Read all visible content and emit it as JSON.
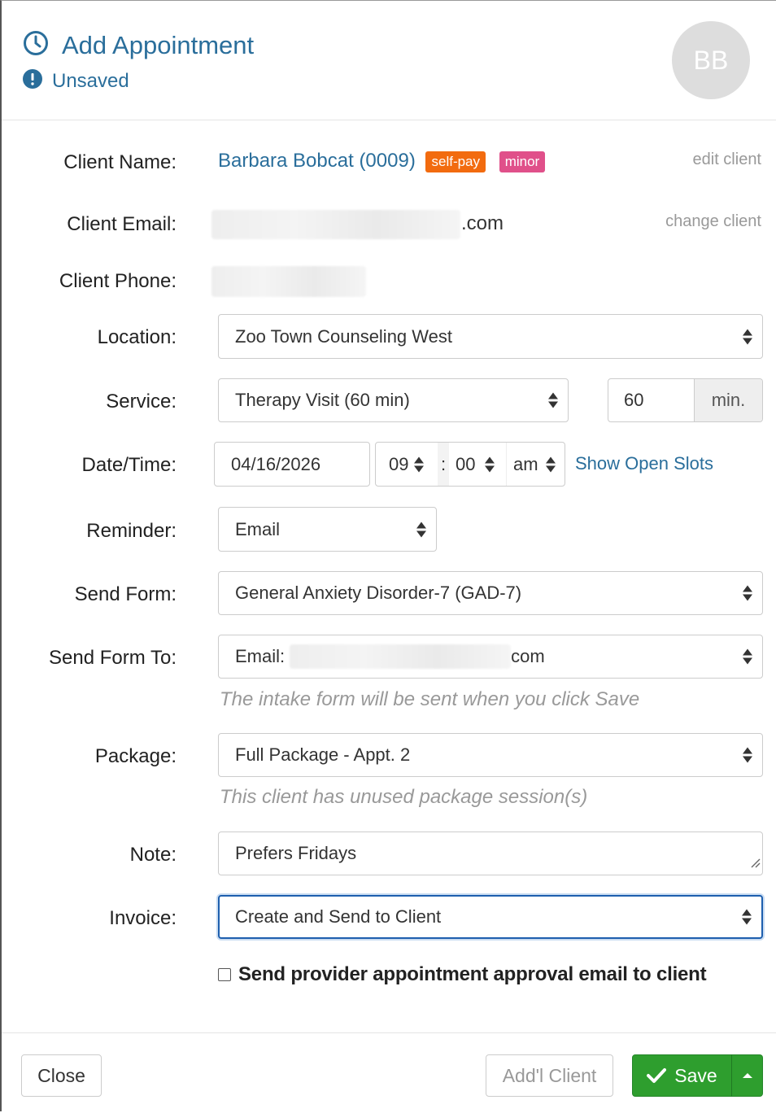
{
  "header": {
    "title": "Add Appointment",
    "status": "Unsaved",
    "avatar_initials": "BB"
  },
  "labels": {
    "client_name": "Client Name:",
    "client_email": "Client Email:",
    "client_phone": "Client Phone:",
    "location": "Location:",
    "service": "Service:",
    "datetime": "Date/Time:",
    "reminder": "Reminder:",
    "send_form": "Send Form:",
    "send_form_to": "Send Form To:",
    "package": "Package:",
    "note": "Note:",
    "invoice": "Invoice:"
  },
  "client": {
    "name": "Barbara Bobcat (0009)",
    "badge_selfpay": "self-pay",
    "badge_minor": "minor",
    "email_suffix": ".com",
    "edit_link": "edit client",
    "change_link": "change client"
  },
  "fields": {
    "location": "Zoo Town Counseling West",
    "service": "Therapy Visit (60 min)",
    "duration": "60",
    "duration_unit": "min.",
    "date": "04/16/2026",
    "hour": "09",
    "time_sep": ":",
    "minute": "00",
    "ampm": "am",
    "show_open_slots": "Show Open Slots",
    "reminder": "Email",
    "send_form": "General Anxiety Disorder-7 (GAD-7)",
    "send_form_to_prefix": "Email:",
    "send_form_to_suffix": "com",
    "send_form_help": "The intake form will be sent when you click Save",
    "package": "Full Package - Appt. 2",
    "package_help": "This client has unused package session(s)",
    "note": "Prefers Fridays",
    "invoice": "Create and Send to Client",
    "approval_checkbox_label": "Send provider appointment approval email to client"
  },
  "footer": {
    "close": "Close",
    "add_client": "Add'l Client",
    "save": "Save"
  },
  "colors": {
    "accent": "#2a6e9b",
    "selfpay_badge": "#f26b0f",
    "minor_badge": "#e0508a",
    "save_green": "#2e9e2e"
  }
}
